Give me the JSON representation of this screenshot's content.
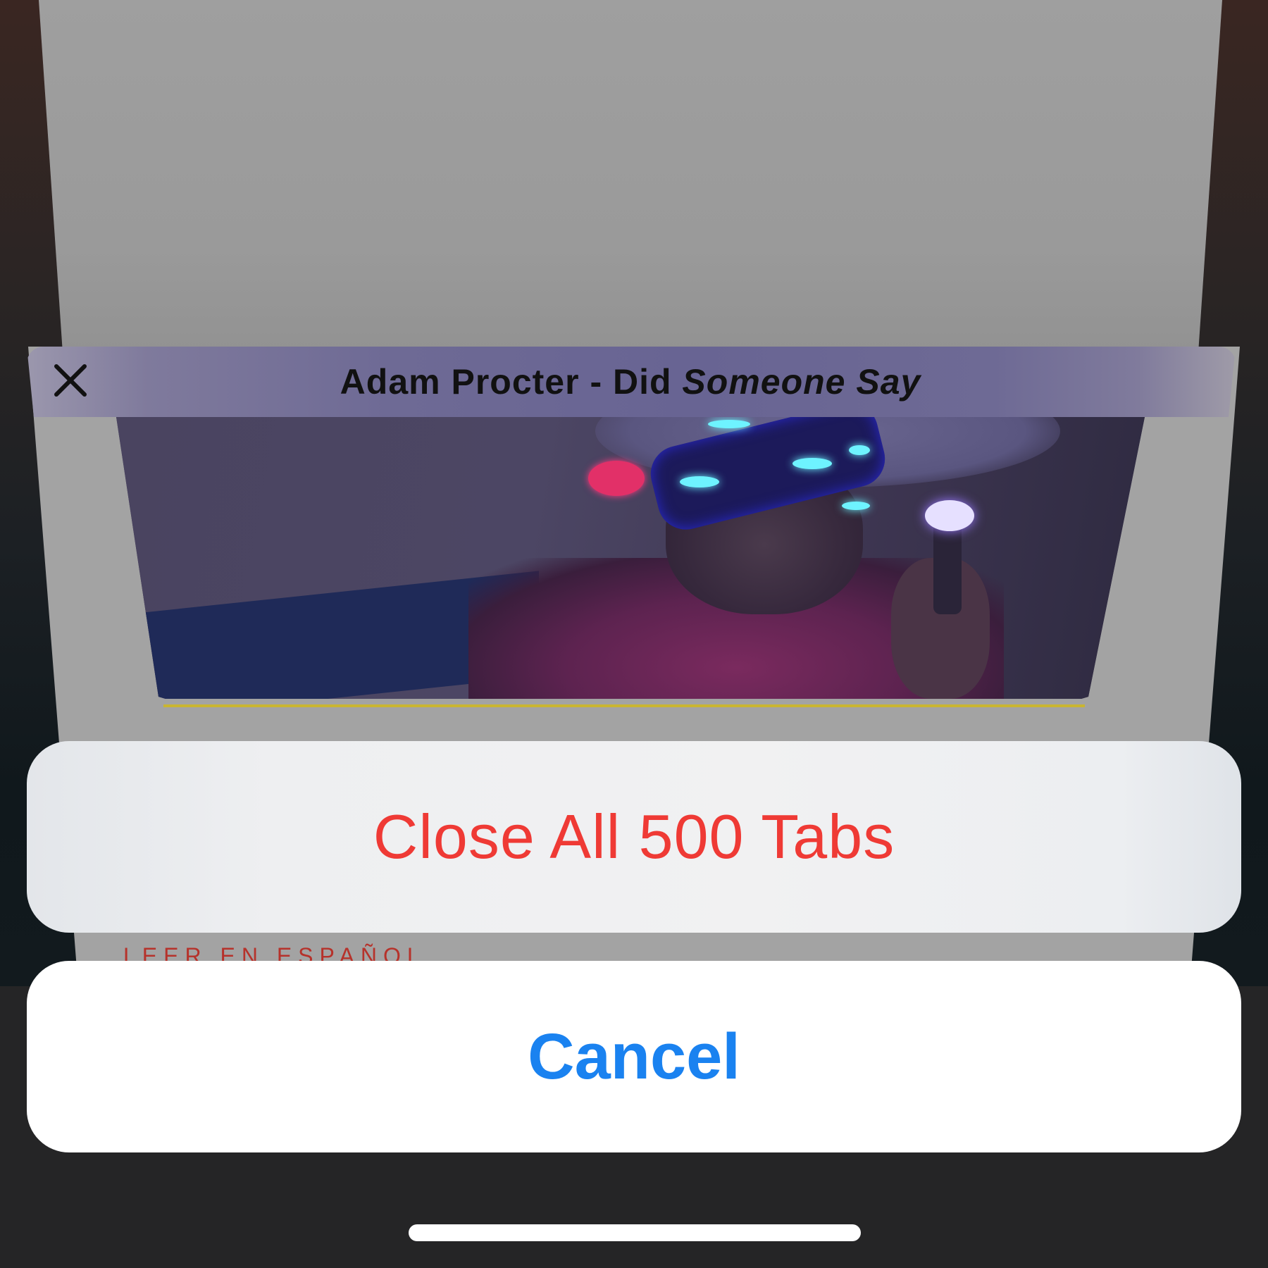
{
  "tab": {
    "title_plain": "Adam Procter - Did ",
    "title_italic": "Someone Say",
    "footer_link": "LEER EN ESPAÑOL"
  },
  "action_sheet": {
    "destructive_label": "Close All 500 Tabs",
    "cancel_label": "Cancel"
  },
  "colors": {
    "destructive": "#ef3a35",
    "cancel": "#1a82f0"
  },
  "icons": {
    "close_tab": "close-icon"
  }
}
